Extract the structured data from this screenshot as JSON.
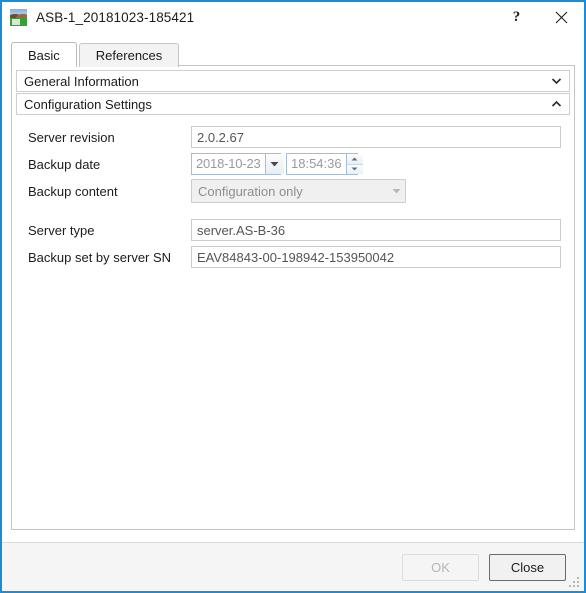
{
  "window": {
    "title": "ASB-1_20181023-185421",
    "icon": "server-backup-icon",
    "help_label": "?",
    "close_label": "✕",
    "accent_color": "#1a8cd8"
  },
  "tabs": [
    {
      "label": "Basic",
      "active": true
    },
    {
      "label": "References",
      "active": false
    }
  ],
  "sections": [
    {
      "label": "General Information",
      "expanded": false,
      "chevron": "chevron-down-icon"
    },
    {
      "label": "Configuration Settings",
      "expanded": true,
      "chevron": "chevron-up-icon"
    }
  ],
  "fields": {
    "server_revision": {
      "label": "Server revision",
      "value": "2.0.2.67"
    },
    "backup_date": {
      "label": "Backup date",
      "date_value": "2018-10-23",
      "time_value": "18:54:36"
    },
    "backup_content": {
      "label": "Backup content",
      "value": "Configuration only"
    },
    "server_type": {
      "label": "Server type",
      "value": "server.AS-B-36"
    },
    "backup_set_by_server_sn": {
      "label": "Backup set by server SN",
      "value": "EAV84843-00-198942-153950042"
    }
  },
  "footer": {
    "ok_label": "OK",
    "close_label": "Close"
  }
}
